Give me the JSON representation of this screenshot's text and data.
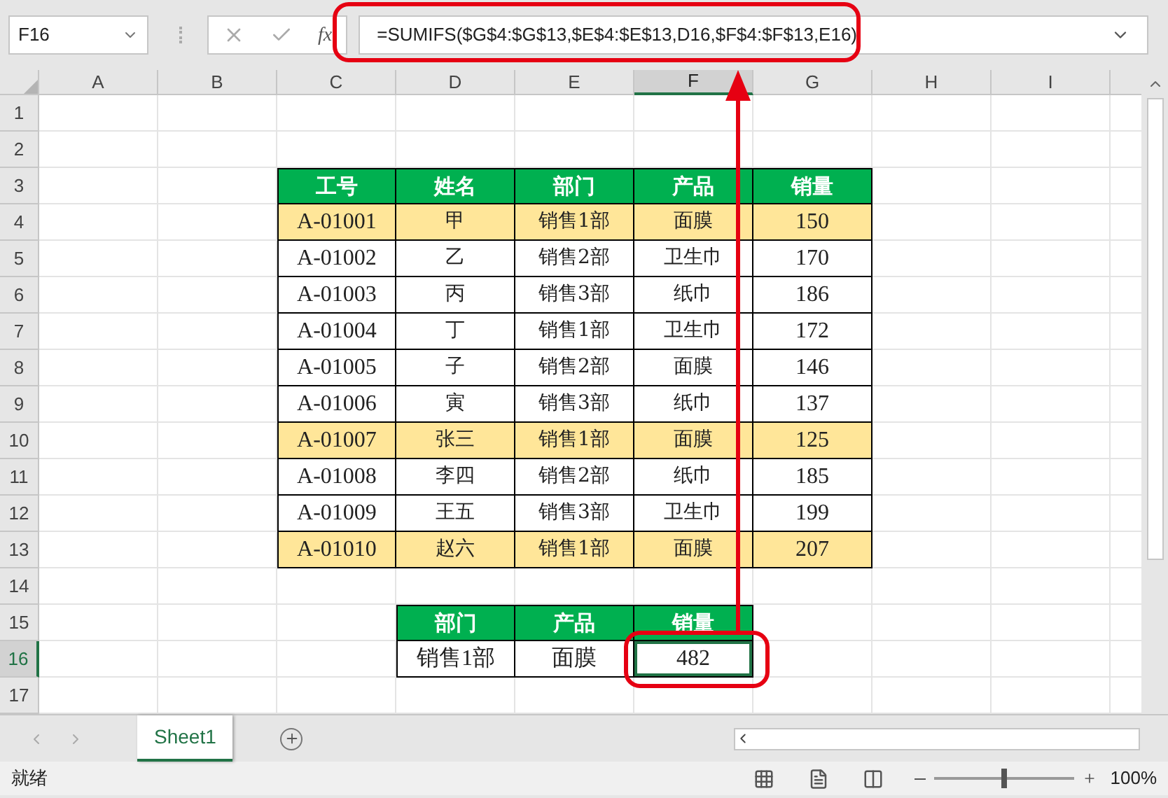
{
  "name_box": "F16",
  "formula_bar": {
    "function_label": "fx",
    "formula": "=SUMIFS($G$4:$G$13,$E$4:$E$13,D16,$F$4:$F$13,E16)"
  },
  "columns": [
    {
      "label": "A",
      "selected": false
    },
    {
      "label": "B",
      "selected": false
    },
    {
      "label": "C",
      "selected": false
    },
    {
      "label": "D",
      "selected": false
    },
    {
      "label": "E",
      "selected": false
    },
    {
      "label": "F",
      "selected": true
    },
    {
      "label": "G",
      "selected": false
    },
    {
      "label": "H",
      "selected": false
    },
    {
      "label": "I",
      "selected": false
    }
  ],
  "rows": [
    {
      "label": "1",
      "selected": false
    },
    {
      "label": "2",
      "selected": false
    },
    {
      "label": "3",
      "selected": false
    },
    {
      "label": "4",
      "selected": false
    },
    {
      "label": "5",
      "selected": false
    },
    {
      "label": "6",
      "selected": false
    },
    {
      "label": "7",
      "selected": false
    },
    {
      "label": "8",
      "selected": false
    },
    {
      "label": "9",
      "selected": false
    },
    {
      "label": "10",
      "selected": false
    },
    {
      "label": "11",
      "selected": false
    },
    {
      "label": "12",
      "selected": false
    },
    {
      "label": "13",
      "selected": false
    },
    {
      "label": "14",
      "selected": false
    },
    {
      "label": "15",
      "selected": false
    },
    {
      "label": "16",
      "selected": true
    },
    {
      "label": "17",
      "selected": false
    }
  ],
  "sales_table": {
    "header": [
      "工号",
      "姓名",
      "部门",
      "产品",
      "销量"
    ],
    "rows": [
      {
        "cells": [
          "A-01001",
          "甲",
          "销售1部",
          "面膜",
          "150"
        ],
        "highlighted": true
      },
      {
        "cells": [
          "A-01002",
          "乙",
          "销售2部",
          "卫生巾",
          "170"
        ],
        "highlighted": false
      },
      {
        "cells": [
          "A-01003",
          "丙",
          "销售3部",
          "纸巾",
          "186"
        ],
        "highlighted": false
      },
      {
        "cells": [
          "A-01004",
          "丁",
          "销售1部",
          "卫生巾",
          "172"
        ],
        "highlighted": false
      },
      {
        "cells": [
          "A-01005",
          "子",
          "销售2部",
          "面膜",
          "146"
        ],
        "highlighted": false
      },
      {
        "cells": [
          "A-01006",
          "寅",
          "销售3部",
          "纸巾",
          "137"
        ],
        "highlighted": false
      },
      {
        "cells": [
          "A-01007",
          "张三",
          "销售1部",
          "面膜",
          "125"
        ],
        "highlighted": true
      },
      {
        "cells": [
          "A-01008",
          "李四",
          "销售2部",
          "纸巾",
          "185"
        ],
        "highlighted": false
      },
      {
        "cells": [
          "A-01009",
          "王五",
          "销售3部",
          "卫生巾",
          "199"
        ],
        "highlighted": false
      },
      {
        "cells": [
          "A-01010",
          "赵六",
          "销售1部",
          "面膜",
          "207"
        ],
        "highlighted": true
      }
    ]
  },
  "lookup_table": {
    "header": [
      "部门",
      "产品",
      "销量"
    ],
    "values": [
      {
        "text": "销售1部",
        "selected": false
      },
      {
        "text": "面膜",
        "selected": false
      },
      {
        "text": "482",
        "selected": true
      }
    ]
  },
  "sheet_tabs": [
    {
      "label": "Sheet1",
      "selected": true
    }
  ],
  "status_bar": {
    "status": "就绪",
    "zoom": "100%",
    "zoom_slider": {
      "level": 0.5
    }
  }
}
